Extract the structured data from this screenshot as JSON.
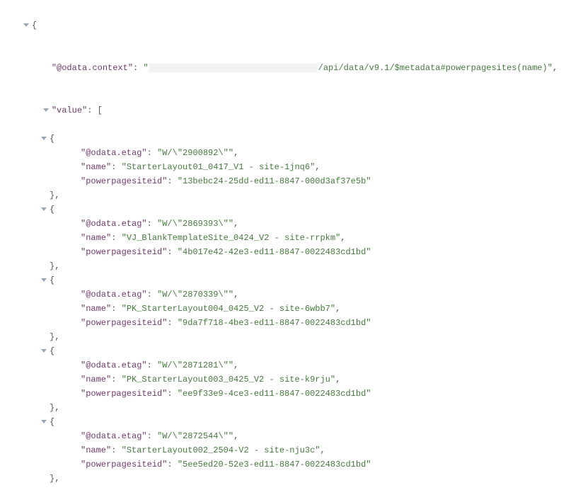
{
  "odata_context_key": "\"@odata.context\"",
  "odata_context_suffix": "/api/data/v9.1/$metadata#powerpagesites(name)\"",
  "value_key": "\"value\"",
  "etag_key": "\"@odata.etag\"",
  "name_key": "\"name\"",
  "siteid_key": "\"powerpagesiteid\"",
  "records": [
    {
      "etag": "\"W/\\\"2900892\\\"\"",
      "name": "\"StarterLayout01_0417_V1 - site-1jnq6\"",
      "siteid": "\"13bebc24-25dd-ed11-8847-000d3af37e5b\""
    },
    {
      "etag": "\"W/\\\"2869393\\\"\"",
      "name": "\"VJ_BlankTemplateSite_0424_V2 - site-rrpkm\"",
      "siteid": "\"4b017e42-42e3-ed11-8847-0022483cd1bd\""
    },
    {
      "etag": "\"W/\\\"2870339\\\"\"",
      "name": "\"PK_StarterLayout004_0425_V2 - site-6wbb7\"",
      "siteid": "\"9da7f718-4be3-ed11-8847-0022483cd1bd\""
    },
    {
      "etag": "\"W/\\\"2871281\\\"\"",
      "name": "\"PK_StarterLayout003_0425_V2 - site-k9rju\"",
      "siteid": "\"ee9f33e9-4ce3-ed11-8847-0022483cd1bd\""
    },
    {
      "etag": "\"W/\\\"2872544\\\"\"",
      "name": "\"StarterLayout002_2504-V2 - site-nju3c\"",
      "siteid": "\"5ee5ed20-52e3-ed11-8847-0022483cd1bd\""
    }
  ]
}
